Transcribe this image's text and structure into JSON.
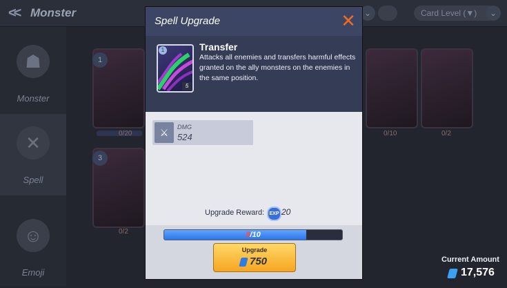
{
  "background": {
    "screen_title": "Monster",
    "sort_label": "Card Level (▼)",
    "sidebar": [
      {
        "label": "Monster",
        "icon": "monster-icon"
      },
      {
        "label": "Spell",
        "icon": "spell-icon"
      },
      {
        "label": "Emoji",
        "icon": "emoji-icon"
      }
    ],
    "cards": [
      {
        "level": "1",
        "count": "0/20"
      },
      {
        "level": "3",
        "count": "0/2"
      },
      {
        "level": "",
        "count": "0/10"
      },
      {
        "level": "",
        "count": "0/2"
      }
    ],
    "currency": {
      "label": "Current Amount",
      "value": "17,576"
    }
  },
  "modal": {
    "title": "Spell Upgrade",
    "close_label": "✕",
    "spell": {
      "name": "Transfer",
      "description": "Attacks all enemies and transfers harmful effects granted on the ally monsters on the enemies in the same position.",
      "level": "1",
      "cost": "5"
    },
    "stat": {
      "label": "DMG",
      "value": "524"
    },
    "reward": {
      "label": "Upgrade Reward:",
      "icon_text": "EXP",
      "value": "20"
    },
    "progress": {
      "current": "8",
      "total": "/10",
      "fraction": 0.8
    },
    "upgrade": {
      "label": "Upgrade",
      "cost": "750"
    }
  },
  "colors": {
    "accent_close": "#f06a20",
    "button_gold": "#f5a621",
    "progress_blue": "#2c76e8"
  }
}
